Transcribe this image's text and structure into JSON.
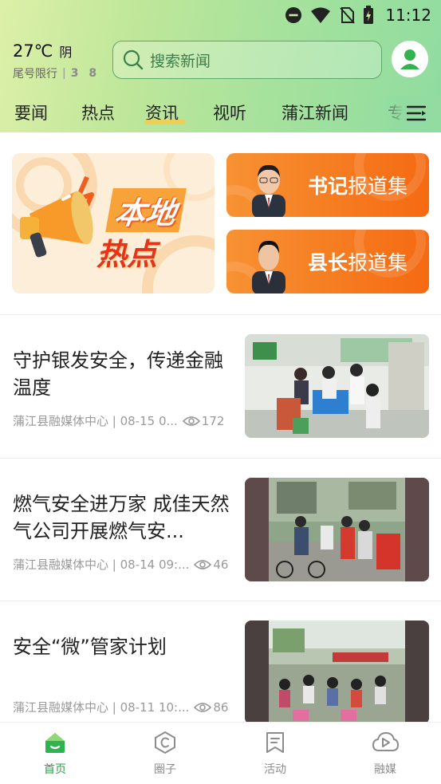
{
  "status_bar": {
    "time": "11:12"
  },
  "weather": {
    "temperature": "27℃",
    "condition": "阴",
    "limit_label": "尾号限行",
    "limit_numbers": "3 8"
  },
  "search": {
    "placeholder": "搜索新闻"
  },
  "tabs": [
    {
      "label": "要闻"
    },
    {
      "label": "热点"
    },
    {
      "label": "资讯",
      "active": true
    },
    {
      "label": "视听"
    },
    {
      "label": "蒲江新闻"
    },
    {
      "label": "专"
    }
  ],
  "banner": {
    "line1": "本地",
    "line2": "热点"
  },
  "reports": [
    {
      "bold": "书记",
      "rest": "报道集"
    },
    {
      "bold": "县长",
      "rest": "报道集"
    }
  ],
  "news": [
    {
      "title": "守护银发安全，传递金融温度",
      "meta": "蒲江县融媒体中心 | 08-15 0...",
      "views": "172"
    },
    {
      "title": "燃气安全进万家 成佳天然气公司开展燃气安...",
      "meta": "蒲江县融媒体中心 | 08-14 09:...",
      "views": "46"
    },
    {
      "title": "安全“微”管家计划",
      "meta": "蒲江县融媒体中心 | 08-11 10:...",
      "views": "86"
    }
  ],
  "bottom_nav": [
    {
      "label": "首页",
      "active": true
    },
    {
      "label": "圈子"
    },
    {
      "label": "活动"
    },
    {
      "label": "融媒"
    }
  ],
  "colors": {
    "accent": "#2f9a4a",
    "report_orange": "#f67a20",
    "header_green": "#a7e29c"
  }
}
